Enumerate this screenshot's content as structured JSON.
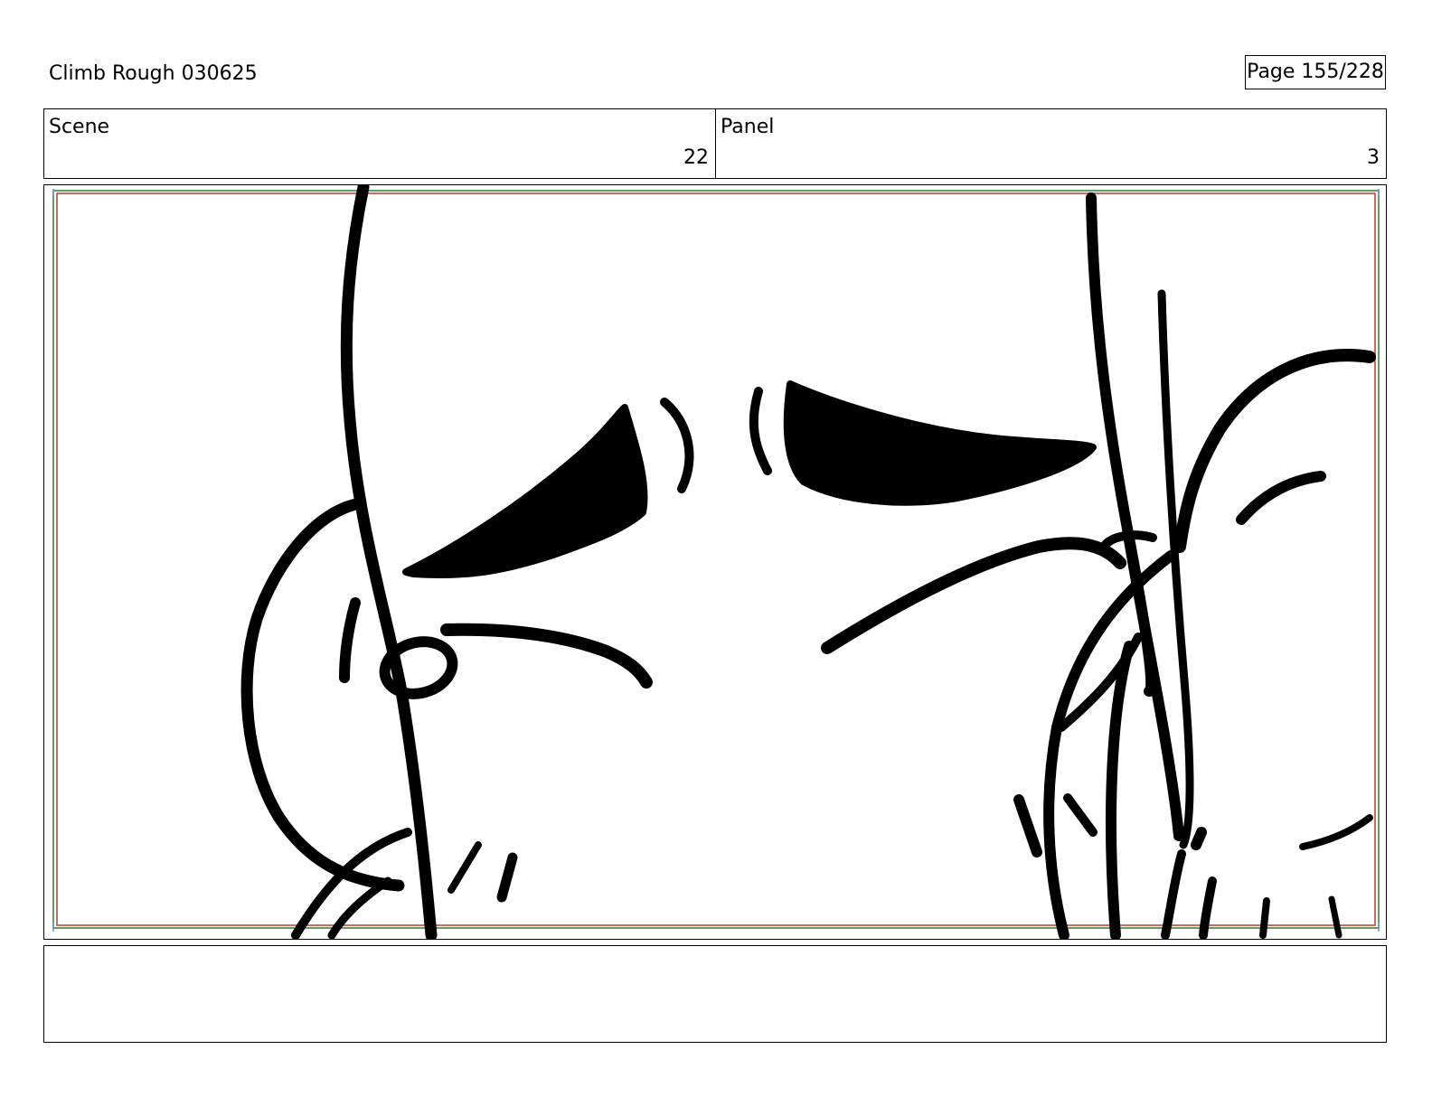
{
  "header": {
    "title": "Climb Rough 030625",
    "page_indicator": "Page 155/228"
  },
  "scene": {
    "label": "Scene",
    "value": "22"
  },
  "panel": {
    "label": "Panel",
    "value": "3"
  },
  "notes": {
    "text": ""
  },
  "colors": {
    "safe_frame_red": "#c0392b",
    "safe_frame_green": "#2e7d32",
    "guide_blue": "#6a8fd8",
    "ink": "#000000"
  }
}
